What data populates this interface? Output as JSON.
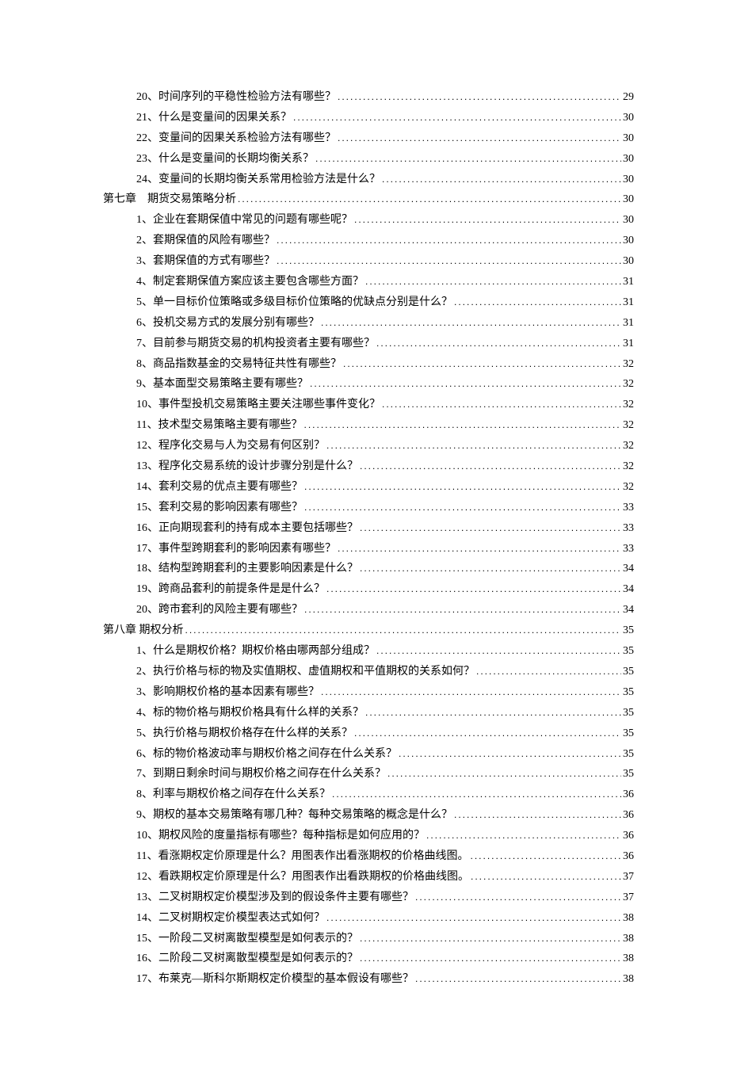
{
  "toc": [
    {
      "level": 2,
      "label": "20、时间序列的平稳性检验方法有哪些？",
      "page": "29"
    },
    {
      "level": 2,
      "label": "21、什么是变量间的因果关系？",
      "page": "30"
    },
    {
      "level": 2,
      "label": "22、变量间的因果关系检验方法有哪些？",
      "page": "30"
    },
    {
      "level": 2,
      "label": "23、什么是变量间的长期均衡关系？",
      "page": "30"
    },
    {
      "level": 2,
      "label": "24、变量间的长期均衡关系常用检验方法是什么？",
      "page": "30"
    },
    {
      "level": 1,
      "label": "第七章　期货交易策略分析",
      "page": "30"
    },
    {
      "level": 2,
      "label": "1、企业在套期保值中常见的问题有哪些呢？",
      "page": "30"
    },
    {
      "level": 2,
      "label": "2、套期保值的风险有哪些？",
      "page": "30"
    },
    {
      "level": 2,
      "label": "3、套期保值的方式有哪些？",
      "page": "30"
    },
    {
      "level": 2,
      "label": "4、制定套期保值方案应该主要包含哪些方面？",
      "page": "31"
    },
    {
      "level": 2,
      "label": "5、单一目标价位策略或多级目标价位策略的优缺点分别是什么？",
      "page": "31"
    },
    {
      "level": 2,
      "label": "6、投机交易方式的发展分别有哪些？",
      "page": "31"
    },
    {
      "level": 2,
      "label": "7、目前参与期货交易的机构投资者主要有哪些？",
      "page": "31"
    },
    {
      "level": 2,
      "label": "8、商品指数基金的交易特征共性有哪些？",
      "page": "32"
    },
    {
      "level": 2,
      "label": "9、基本面型交易策略主要有哪些？",
      "page": "32"
    },
    {
      "level": 2,
      "label": "10、事件型投机交易策略主要关注哪些事件变化？",
      "page": "32"
    },
    {
      "level": 2,
      "label": "11、技术型交易策略主要有哪些？",
      "page": "32"
    },
    {
      "level": 2,
      "label": "12、程序化交易与人为交易有何区别？",
      "page": "32"
    },
    {
      "level": 2,
      "label": "13、程序化交易系统的设计步骤分别是什么？",
      "page": "32"
    },
    {
      "level": 2,
      "label": "14、套利交易的优点主要有哪些？",
      "page": "32"
    },
    {
      "level": 2,
      "label": "15、套利交易的影响因素有哪些？",
      "page": "33"
    },
    {
      "level": 2,
      "label": "16、正向期现套利的持有成本主要包括哪些？",
      "page": "33"
    },
    {
      "level": 2,
      "label": "17、事件型跨期套利的影响因素有哪些？",
      "page": "33"
    },
    {
      "level": 2,
      "label": "18、结构型跨期套利的主要影响因素是什么？",
      "page": "34"
    },
    {
      "level": 2,
      "label": "19、跨商品套利的前提条件是是什么？",
      "page": "34"
    },
    {
      "level": 2,
      "label": "20、跨市套利的风险主要有哪些？",
      "page": "34"
    },
    {
      "level": 1,
      "label": "第八章 期权分析",
      "page": "35"
    },
    {
      "level": 2,
      "label": "1、什么是期权价格？期权价格由哪两部分组成？",
      "page": "35"
    },
    {
      "level": 2,
      "label": "2、执行价格与标的物及实值期权、虚值期权和平值期权的关系如何？",
      "page": "35"
    },
    {
      "level": 2,
      "label": "3、影响期权价格的基本因素有哪些？",
      "page": "35"
    },
    {
      "level": 2,
      "label": "4、标的物价格与期权价格具有什么样的关系？",
      "page": "35"
    },
    {
      "level": 2,
      "label": "5、执行价格与期权价格存在什么样的关系？",
      "page": "35"
    },
    {
      "level": 2,
      "label": "6、标的物价格波动率与期权价格之间存在什么关系？",
      "page": "35"
    },
    {
      "level": 2,
      "label": "7、到期日剩余时间与期权价格之间存在什么关系？",
      "page": "35"
    },
    {
      "level": 2,
      "label": "8、利率与期权价格之间存在什么关系？",
      "page": "36"
    },
    {
      "level": 2,
      "label": "9、期权的基本交易策略有哪几种？每种交易策略的概念是什么？",
      "page": "36"
    },
    {
      "level": 2,
      "label": "10、期权风险的度量指标有哪些？每种指标是如何应用的？",
      "page": "36"
    },
    {
      "level": 2,
      "label": "11、看涨期权定价原理是什么？用图表作出看涨期权的价格曲线图。",
      "page": "36"
    },
    {
      "level": 2,
      "label": "12、看跌期权定价原理是什么？用图表作出看跌期权的价格曲线图。",
      "page": "37"
    },
    {
      "level": 2,
      "label": "13、二叉树期权定价模型涉及到的假设条件主要有哪些？",
      "page": "37"
    },
    {
      "level": 2,
      "label": "14、二叉树期权定价模型表达式如何？",
      "page": "38"
    },
    {
      "level": 2,
      "label": "15、一阶段二叉树离散型模型是如何表示的？",
      "page": "38"
    },
    {
      "level": 2,
      "label": "16、二阶段二叉树离散型模型是如何表示的？",
      "page": "38"
    },
    {
      "level": 2,
      "label": "17、布莱克―斯科尔斯期权定价模型的基本假设有哪些？",
      "page": "38"
    }
  ]
}
